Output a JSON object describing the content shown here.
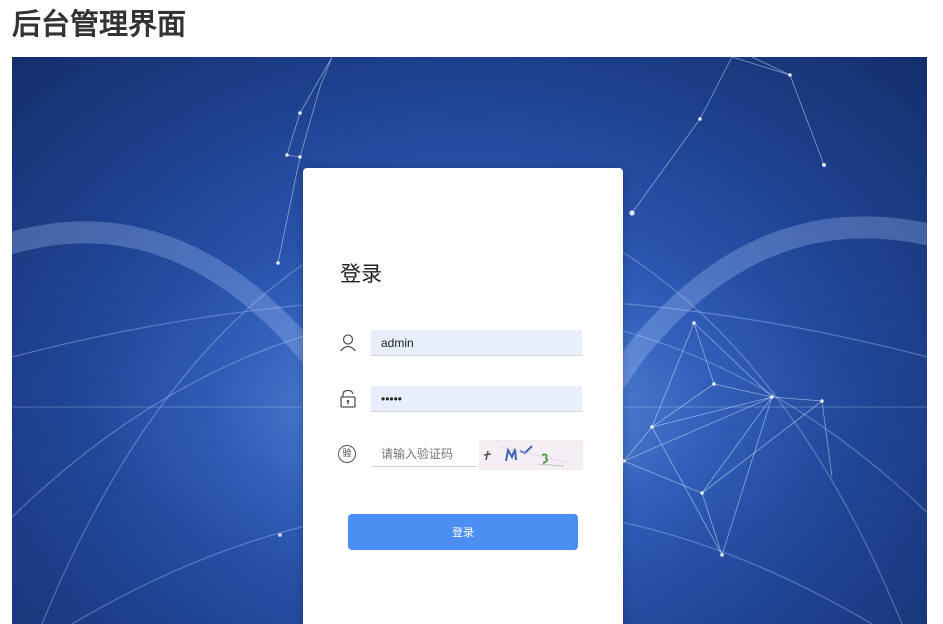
{
  "page": {
    "heading": "后台管理界面"
  },
  "login": {
    "title": "登录",
    "username": {
      "value": "admin",
      "icon": "user-icon"
    },
    "password": {
      "value": "•••••",
      "icon": "unlock-icon"
    },
    "captcha": {
      "placeholder": "请输入验证码",
      "icon": "verify-icon",
      "badge": "验"
    },
    "submit_label": "登录"
  },
  "colors": {
    "background": "#2c58b3",
    "card": "#ffffff",
    "input_fill": "#e8eefb",
    "button": "#4d8ef2"
  }
}
